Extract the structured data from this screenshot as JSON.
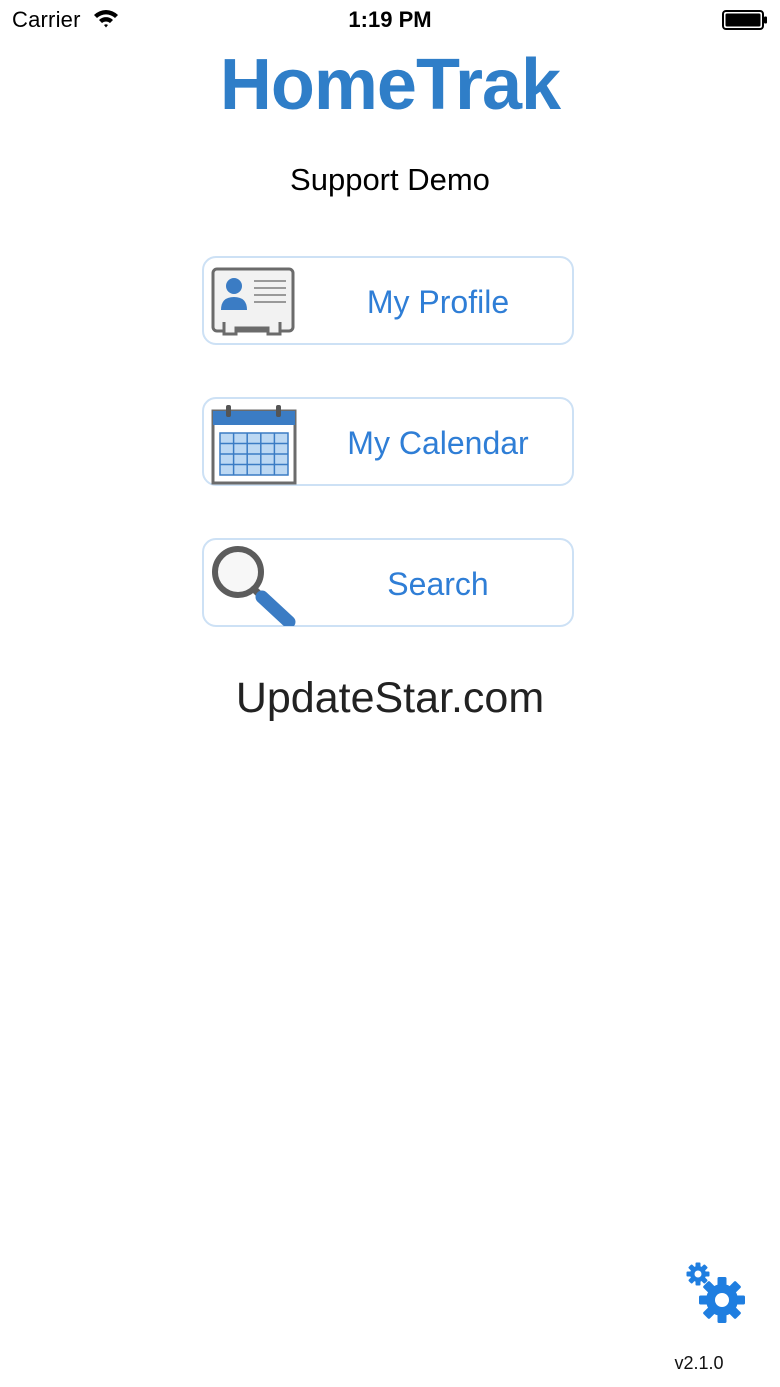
{
  "status_bar": {
    "carrier": "Carrier",
    "time": "1:19 PM",
    "wifi_icon": "wifi-icon",
    "battery_icon": "battery-icon"
  },
  "app": {
    "title": "HomeTrak",
    "subtitle": "Support Demo",
    "brand_color": "#2f7ec8"
  },
  "menu": {
    "items": [
      {
        "label": "My Profile",
        "icon": "profile-card-icon"
      },
      {
        "label": "My Calendar",
        "icon": "calendar-icon"
      },
      {
        "label": "Search",
        "icon": "magnifier-icon"
      }
    ],
    "label_color": "#2f7ed6",
    "border_color": "#cde1f5"
  },
  "watermark": "UpdateStar.com",
  "footer": {
    "settings_icon": "gears-icon",
    "version": "v2.1.0"
  }
}
